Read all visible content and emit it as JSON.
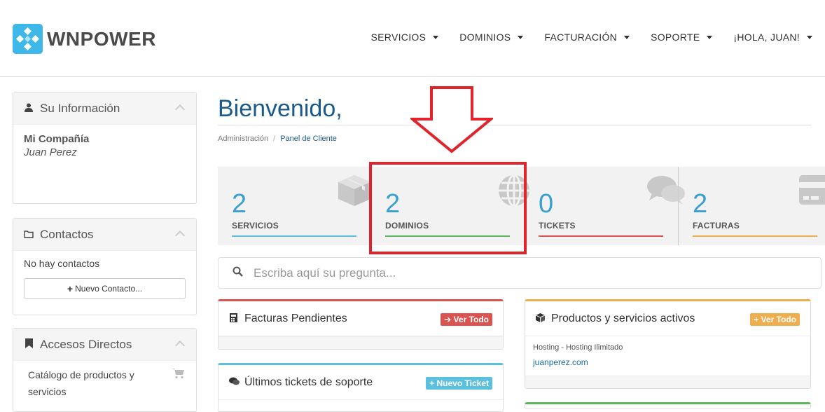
{
  "brand": {
    "name": "WNPOWER"
  },
  "nav": {
    "items": [
      {
        "label": "SERVICIOS"
      },
      {
        "label": "DOMINIOS"
      },
      {
        "label": "FACTURACIÓN"
      },
      {
        "label": "SOPORTE"
      },
      {
        "label": "¡HOLA, JUAN!"
      }
    ]
  },
  "sidebar": {
    "info": {
      "title": "Su Información",
      "company": "Mi Compañía",
      "name": "Juan Perez"
    },
    "contacts": {
      "title": "Contactos",
      "empty": "No hay contactos",
      "button": "Nuevo Contacto..."
    },
    "shortcuts": {
      "title": "Accesos Directos",
      "item": "Catálogo de productos y servicios"
    }
  },
  "main": {
    "title": "Bienvenido,",
    "breadcrumb": {
      "root": "Administración",
      "sep": "/",
      "current": "Panel de Cliente"
    },
    "tiles": [
      {
        "value": "2",
        "label": "SERVICIOS",
        "color": "#5bc0de",
        "icon": "cube-icon"
      },
      {
        "value": "2",
        "label": "DOMINIOS",
        "color": "#5cb85c",
        "icon": "globe-icon"
      },
      {
        "value": "0",
        "label": "TICKETS",
        "color": "#d9534f",
        "icon": "comments-icon"
      },
      {
        "value": "2",
        "label": "FACTURAS",
        "color": "#f0ad4e",
        "icon": "credit-card-icon"
      }
    ],
    "search": {
      "placeholder": "Escriba aquí su pregunta..."
    },
    "cards": {
      "invoices": {
        "title": "Facturas Pendientes",
        "button": "Ver Todo",
        "color": "#d9534f"
      },
      "products": {
        "title": "Productos y servicios activos",
        "button": "Ver Todo",
        "color": "#f0ad4e",
        "item": "Hosting - Hosting Ilimitado",
        "domain": "juanperez.com"
      },
      "tickets": {
        "title": "Últimos tickets de soporte",
        "button": "Nuevo Ticket",
        "color": "#5bc0de"
      }
    }
  },
  "colors": {
    "brand": "#3eb8e8",
    "title": "#1a5a8a",
    "annotation": "#e0242b"
  }
}
